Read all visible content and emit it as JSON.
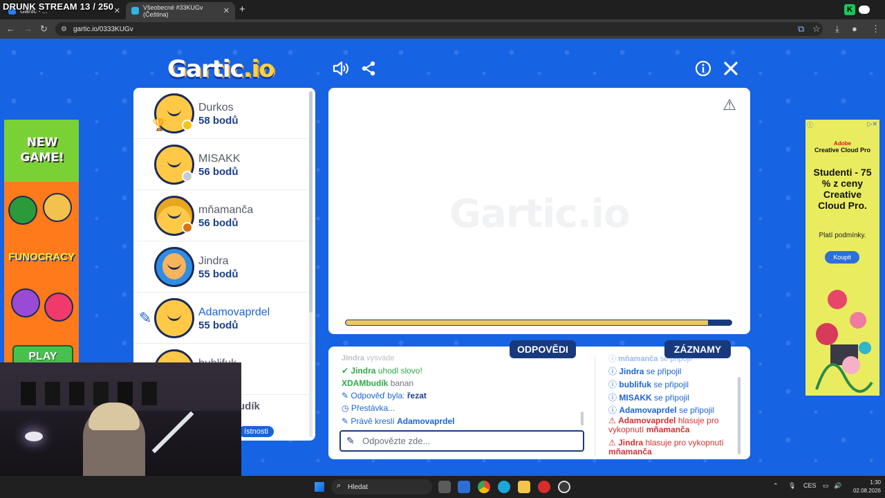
{
  "stream_overlay": {
    "title": "DRUNK STREAM 13 / 250"
  },
  "browser": {
    "tabs": [
      {
        "label": "Gartic - ...",
        "active": false
      },
      {
        "label": "Všeobecné #33KUGv (Čeština)",
        "active": true
      }
    ],
    "url": "gartic.io/0333KUGv"
  },
  "game": {
    "logo": {
      "main": "Gartic",
      "suffix": ".io"
    },
    "players": [
      {
        "name": "Durkos",
        "score": "58 bodů",
        "status_color": "#f5c518",
        "leader": true
      },
      {
        "name": "MISAKK",
        "score": "56 bodů",
        "status_color": "#c7cbd2"
      },
      {
        "name": "mňamanča",
        "score": "56 bodů",
        "status_color": "#d9731a"
      },
      {
        "name": "Jindra",
        "score": "55 bodů"
      },
      {
        "name": "Adamovaprdel",
        "score": "55 bodů",
        "drawing": true
      },
      {
        "name": "bublifuk",
        "score": ""
      }
    ],
    "partial_player": {
      "name": "udík",
      "badge": "ístnosti"
    },
    "watermark": "Gartic.io",
    "timer_progress": 0.94,
    "chat": {
      "tab_answers": "ODPOVĚDI",
      "tab_records": "ZÁZNAMY",
      "answers": [
        {
          "user": "Jindra",
          "text": "vysváde",
          "faded": true
        },
        {
          "user": "Jindra",
          "text": "uhodl slovo!",
          "type": "correct"
        },
        {
          "user": "XDAMbudík",
          "text": "banan",
          "type": "guess"
        },
        {
          "prefix": "Odpověď byla:",
          "value": "řezat",
          "type": "answer-was"
        },
        {
          "text": "Přestávka...",
          "type": "pause"
        },
        {
          "prefix": "Právě kreslí",
          "value": "Adamovaprdel",
          "type": "now-drawing"
        }
      ],
      "input_placeholder": "Odpovězte zde...",
      "records": [
        {
          "user": "mňamanča",
          "text": "se připojil",
          "faded": true
        },
        {
          "user": "Jindra",
          "text": "se připojil"
        },
        {
          "user": "bublifuk",
          "text": "se připojil"
        },
        {
          "user": "MISAKK",
          "text": "se připojil"
        },
        {
          "user": "Adamovaprdel",
          "text": "se připojil"
        },
        {
          "user": "Adamovaprdel",
          "text": "hlasuje pro",
          "line2": "vykopnutí",
          "target": "mňamanča",
          "type": "vote"
        },
        {
          "user": "Jindra",
          "text": "hlasuje pro vykopnutí",
          "target": "mňamanča",
          "type": "vote"
        }
      ]
    }
  },
  "ads": {
    "left": {
      "headline": "NEW GAME!",
      "brand": "FUNOCRACY",
      "cta": "PLAY"
    },
    "right": {
      "brand": "Adobe",
      "product": "Creative Cloud Pro",
      "headline": "Studenti - 75 % z ceny Creative Cloud Pro.",
      "terms": "Platí podmínky.",
      "cta": "Koupit"
    }
  },
  "taskbar": {
    "search": "Hledat",
    "language": "CES",
    "time": "1:30",
    "date": "02.08.2026"
  }
}
